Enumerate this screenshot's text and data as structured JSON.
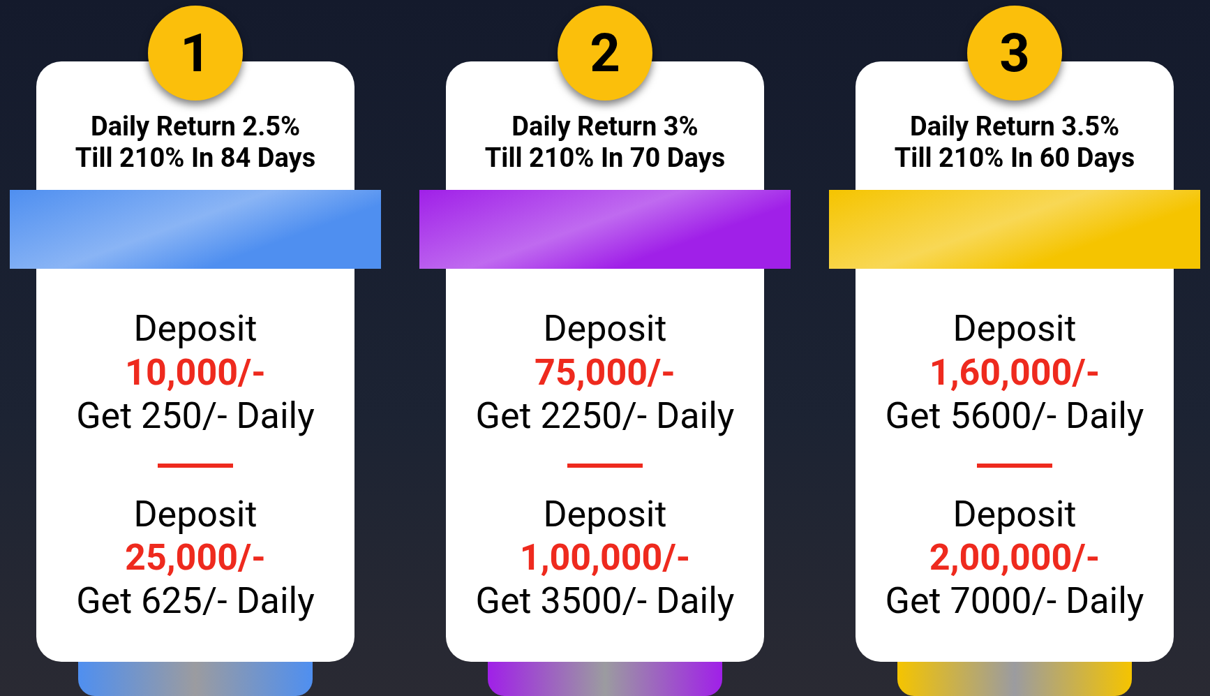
{
  "plans": [
    {
      "number": "1",
      "title_line_1": "Daily Return 2.5%",
      "title_line_2": "Till 210% In 84 Days",
      "color": "#4f8ff0",
      "offers": [
        {
          "label": "Deposit",
          "amount": "10,000/-",
          "return": "Get 250/- Daily"
        },
        {
          "label": "Deposit",
          "amount": "25,000/-",
          "return": "Get 625/- Daily"
        }
      ]
    },
    {
      "number": "2",
      "title_line_1": "Daily Return 3%",
      "title_line_2": "Till 210% In 70 Days",
      "color": "#a020e8",
      "offers": [
        {
          "label": "Deposit",
          "amount": "75,000/-",
          "return": "Get 2250/- Daily"
        },
        {
          "label": "Deposit",
          "amount": "1,00,000/-",
          "return": "Get 3500/- Daily"
        }
      ]
    },
    {
      "number": "3",
      "title_line_1": "Daily Return 3.5%",
      "title_line_2": "Till 210% In 60 Days",
      "color": "#f5c400",
      "offers": [
        {
          "label": "Deposit",
          "amount": "1,60,000/-",
          "return": "Get 5600/- Daily"
        },
        {
          "label": "Deposit",
          "amount": "2,00,000/-",
          "return": "Get 7000/- Daily"
        }
      ]
    }
  ]
}
